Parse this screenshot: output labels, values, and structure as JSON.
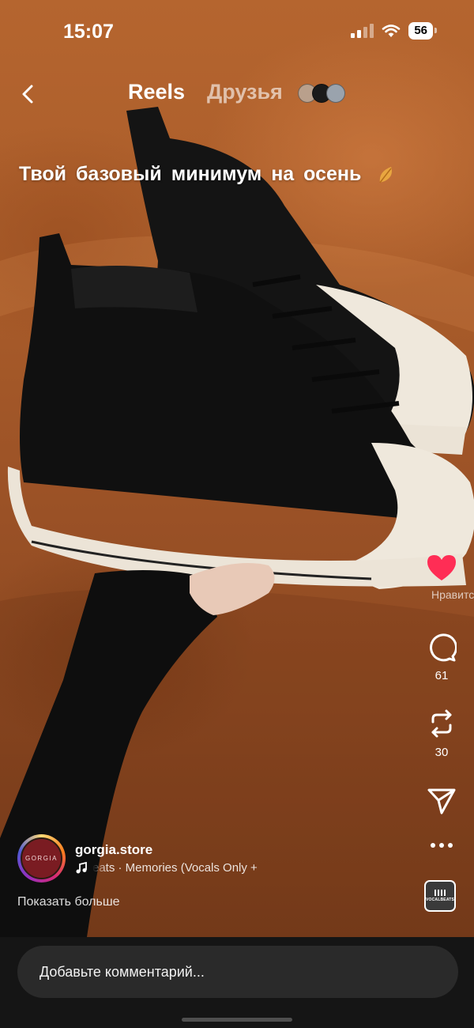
{
  "status_bar": {
    "time": "15:07",
    "battery": "56"
  },
  "nav": {
    "back_icon": "chevron-left-icon",
    "reels_label": "Reels",
    "friends_label": "Друзья"
  },
  "caption": {
    "text": "Твой  базовый  минимум на осень",
    "emoji": "fallen-leaf-icon"
  },
  "actions": {
    "like_label": "Нравится",
    "like_color": "#ff2d55",
    "comments_count": "61",
    "reposts_count": "30"
  },
  "author": {
    "username": "gorgia.store",
    "avatar_text": "GORGIA",
    "music_text": "eats · Memories (Vocals Only +",
    "show_more": "Показать больше",
    "music_thumb_text": "VOCALBEATS"
  },
  "comment": {
    "placeholder": "Добавьте комментарий..."
  }
}
